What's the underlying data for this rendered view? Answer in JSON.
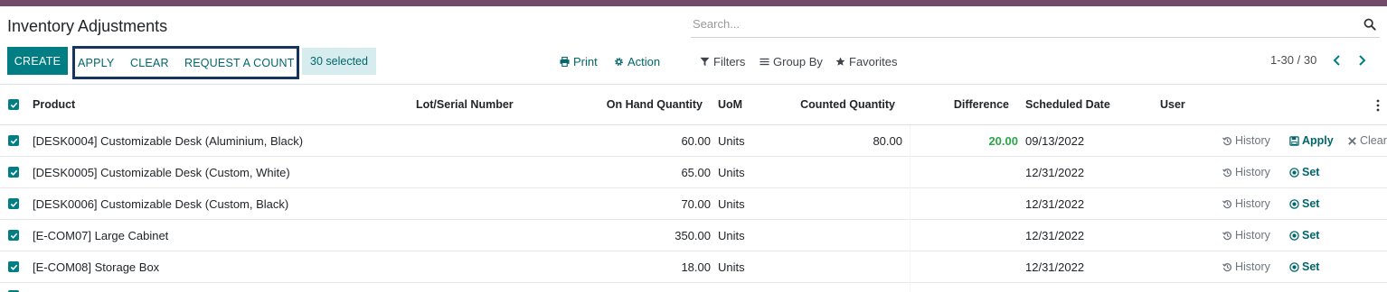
{
  "header": {
    "title": "Inventory Adjustments",
    "search_placeholder": "Search..."
  },
  "toolbar": {
    "create": "CREATE",
    "apply": "APPLY",
    "clear": "CLEAR",
    "request_count": "REQUEST A COUNT",
    "selected": "30 selected",
    "print": "Print",
    "action": "Action",
    "filters": "Filters",
    "group_by": "Group By",
    "favorites": "Favorites",
    "pager": "1-30 / 30"
  },
  "table": {
    "columns": {
      "product": "Product",
      "lot": "Lot/Serial Number",
      "on_hand": "On Hand Quantity",
      "uom": "UoM",
      "counted": "Counted Quantity",
      "difference": "Difference",
      "scheduled": "Scheduled Date",
      "user": "User"
    },
    "row_actions": {
      "history": "History",
      "apply": "Apply",
      "clear": "Clear",
      "set": "Set"
    },
    "rows": [
      {
        "product": "[DESK0004] Customizable Desk (Aluminium, Black)",
        "on_hand": "60.00",
        "uom": "Units",
        "counted": "80.00",
        "difference": "20.00",
        "date": "09/13/2022"
      },
      {
        "product": "[DESK0005] Customizable Desk (Custom, White)",
        "on_hand": "65.00",
        "uom": "Units",
        "counted": "",
        "difference": "",
        "date": "12/31/2022"
      },
      {
        "product": "[DESK0006] Customizable Desk (Custom, Black)",
        "on_hand": "70.00",
        "uom": "Units",
        "counted": "",
        "difference": "",
        "date": "12/31/2022"
      },
      {
        "product": "[E-COM07] Large Cabinet",
        "on_hand": "350.00",
        "uom": "Units",
        "counted": "",
        "difference": "",
        "date": "12/31/2022"
      },
      {
        "product": "[E-COM08] Storage Box",
        "on_hand": "18.00",
        "uom": "Units",
        "counted": "",
        "difference": "",
        "date": "12/31/2022"
      }
    ]
  },
  "colors": {
    "brand": "#714B67",
    "primary": "#017E84",
    "positive": "#28a745"
  }
}
